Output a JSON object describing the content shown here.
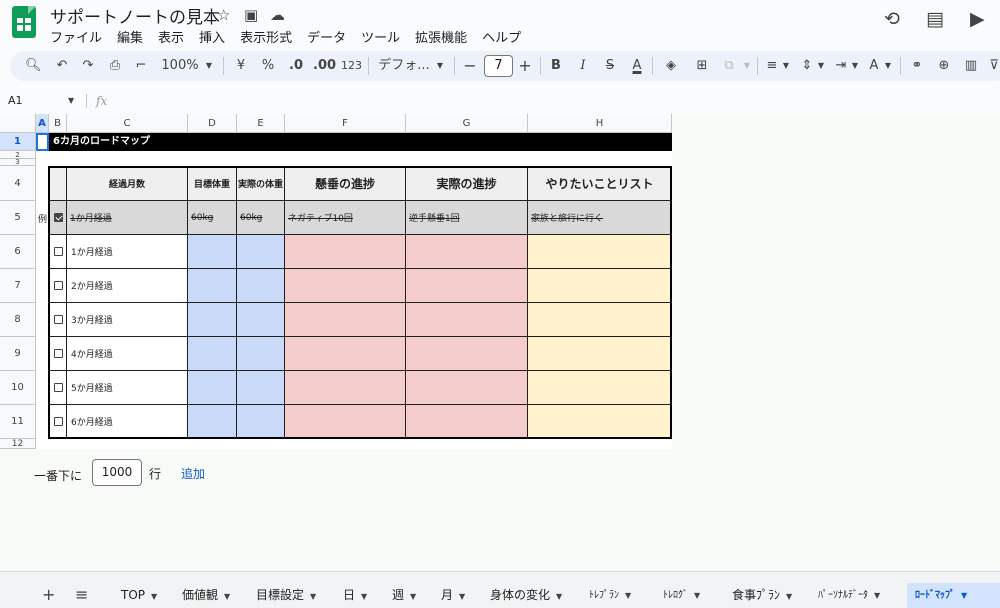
{
  "header": {
    "title": "サポートノートの見本",
    "menu": [
      "ファイル",
      "編集",
      "表示",
      "挿入",
      "表示形式",
      "データ",
      "ツール",
      "拡張機能",
      "ヘルプ"
    ]
  },
  "toolbar": {
    "zoom": "100%",
    "currency": "¥",
    "percent": "%",
    "dec_decrease": ".0",
    "dec_increase": ".00",
    "number_format": "123",
    "font": "デフォ...",
    "font_size": "7",
    "bold": "B",
    "italic": "I",
    "text_color": "A"
  },
  "formula_bar": {
    "cell_ref": "A1",
    "fx": "fx",
    "value": ""
  },
  "columns": [
    "A",
    "B",
    "C",
    "D",
    "E",
    "F",
    "G",
    "H"
  ],
  "rows": [
    "1",
    "2",
    "3",
    "4",
    "5",
    "6",
    "7",
    "8",
    "9",
    "10",
    "11",
    "12"
  ],
  "sheet": {
    "title": "6カ月のロードマップ",
    "example_label": "例",
    "headers": {
      "month": "経過月数",
      "target_weight": "目標体重",
      "actual_weight": "実際の体重",
      "hope_progress": "懸垂の進捗",
      "actual_progress": "実際の進捗",
      "wishlist": "やりたいことリスト"
    },
    "example_row": {
      "month": "1か月経過",
      "target_weight": "60kg",
      "actual_weight": "60kg",
      "hope_progress": "ネガティブ10回",
      "actual_progress": "逆手懸垂1回",
      "wishlist": "家族と旅行に行く"
    },
    "months": [
      "1か月経過",
      "2か月経過",
      "3か月経過",
      "4か月経過",
      "5か月経過",
      "6か月経過"
    ]
  },
  "add_rows": {
    "prefix": "一番下に",
    "count": "1000",
    "suffix": "行",
    "button": "追加"
  },
  "tabs": [
    {
      "label": "TOP"
    },
    {
      "label": "価値観"
    },
    {
      "label": "目標設定"
    },
    {
      "label": "日"
    },
    {
      "label": "週"
    },
    {
      "label": "月"
    },
    {
      "label": "身体の変化"
    },
    {
      "label": "ﾄﾚﾌﾟﾗﾝ"
    },
    {
      "label": "ﾄﾚﾛｸﾞ"
    },
    {
      "label": "食事ﾌﾟﾗﾝ"
    },
    {
      "label": "ﾊﾟｰｿﾅﾙﾃﾞｰﾀ"
    },
    {
      "label": "ﾛｰﾄﾞﾏｯﾌﾟ"
    }
  ],
  "colors": {
    "blue": "#c9daf8",
    "pink": "#f4cccc",
    "yellow": "#fff2cc",
    "active_tab": "#d3e3fd"
  }
}
